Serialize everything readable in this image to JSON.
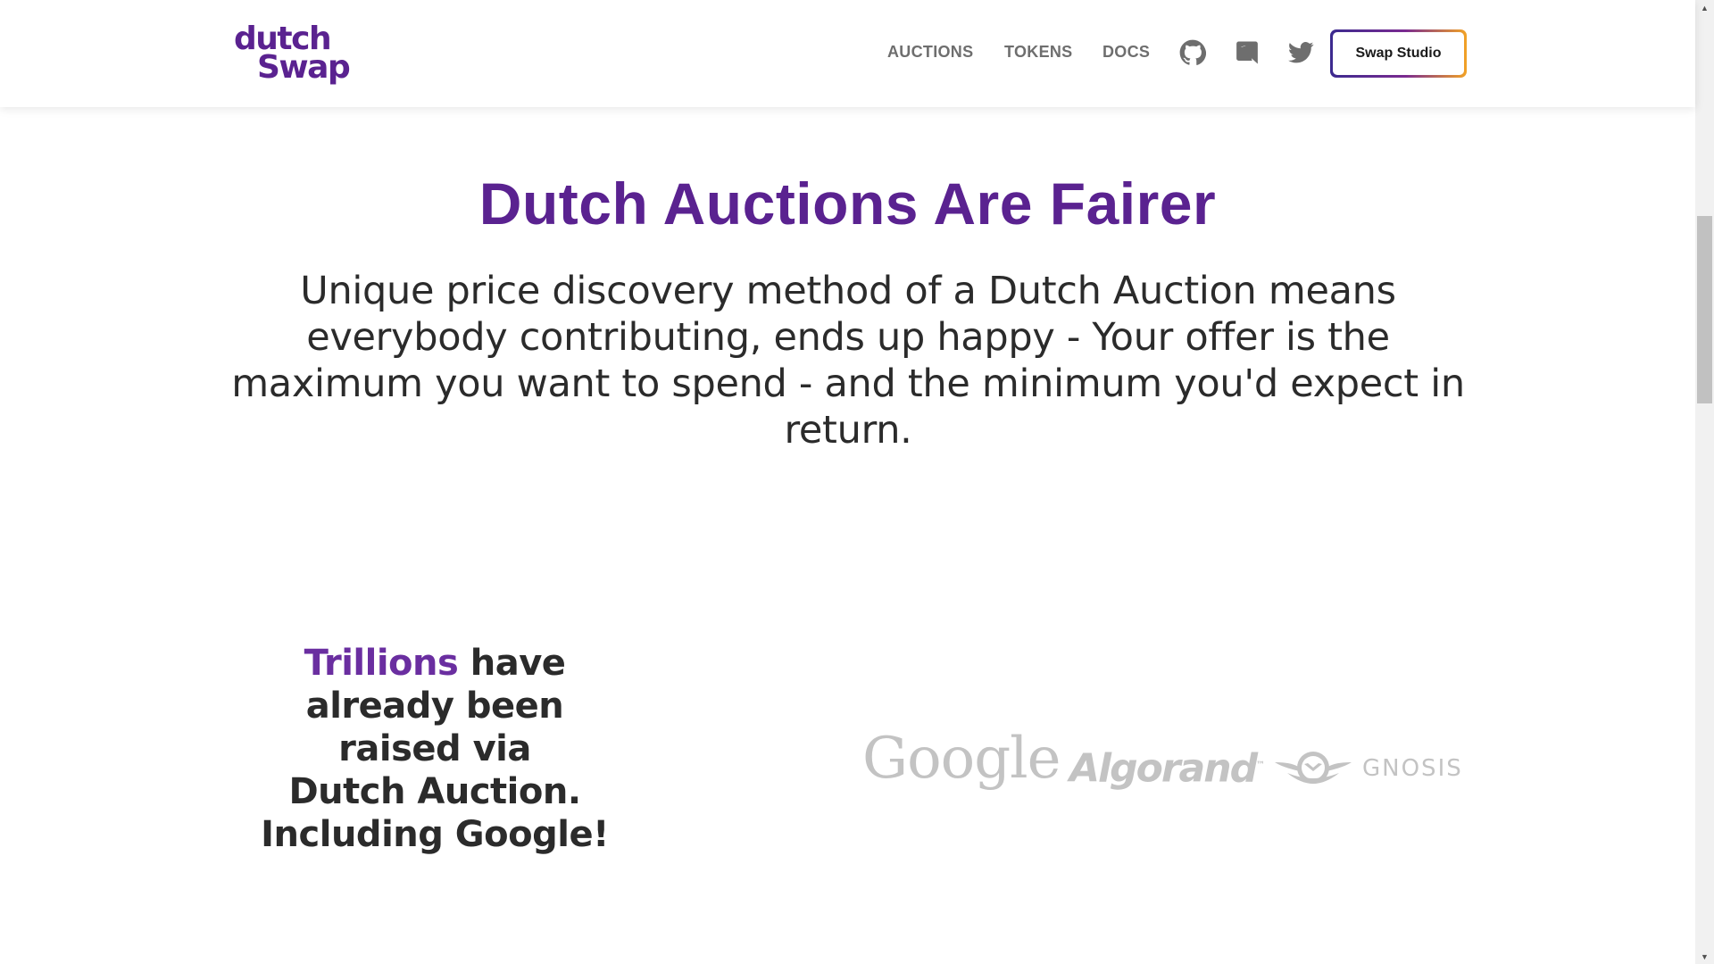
{
  "header": {
    "logo_line1": "dutch",
    "logo_line2": "Swap",
    "nav": [
      {
        "label": "AUCTIONS"
      },
      {
        "label": "TOKENS"
      },
      {
        "label": "DOCS"
      }
    ],
    "social_icons": [
      "github-icon",
      "discord-icon",
      "twitter-icon"
    ],
    "cta_label": "Swap Studio"
  },
  "hero": {
    "title": "Dutch Auctions Are Fairer",
    "text": "Unique price discovery method of a Dutch Auction means everybody contributing, ends up happy - Your offer is the maximum you want to spend - and the minimum you'd expect in return."
  },
  "trillions": {
    "accent": "Trillions",
    "line1_rest": " have",
    "line2": "already been",
    "line3": "raised via",
    "line4": "Dutch Auction.",
    "line5": "Including Google!"
  },
  "partners": {
    "google": "Google",
    "algorand": "Algorand",
    "algorand_tm": "™",
    "gnosis": "GNOSIS"
  },
  "colors": {
    "brand_purple": "#5a2290",
    "nav_gray": "#6e6e6e",
    "logo_gray": "#c3c3c3",
    "cta_gradient_start": "#3b2a8f",
    "cta_gradient_end": "#f2a325"
  }
}
